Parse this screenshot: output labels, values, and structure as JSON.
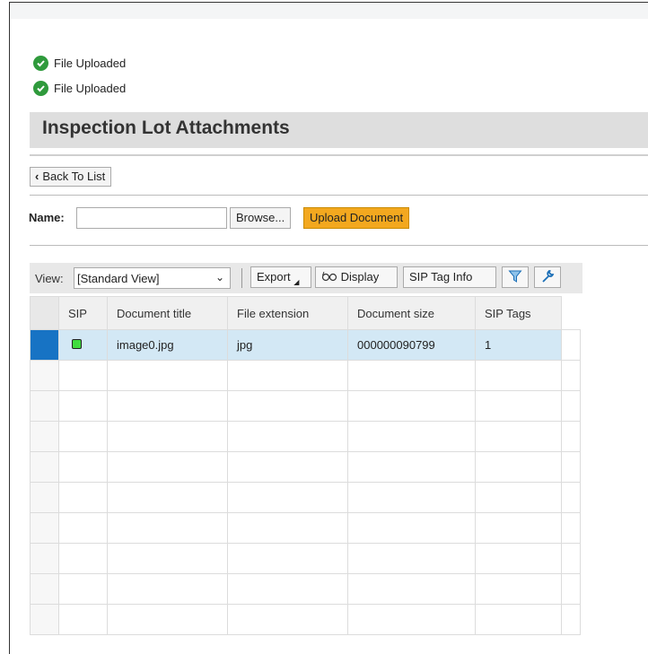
{
  "messages": [
    {
      "text": "File Uploaded",
      "icon": "success-check-icon"
    },
    {
      "text": "File Uploaded",
      "icon": "success-check-icon"
    }
  ],
  "page": {
    "title": "Inspection Lot Attachments"
  },
  "nav": {
    "back_label": "Back To List"
  },
  "upload": {
    "name_label": "Name:",
    "name_value": "",
    "browse_label": "Browse...",
    "upload_label": "Upload Document"
  },
  "toolbar": {
    "view_label": "View:",
    "view_value": "[Standard View]",
    "export_label": "Export",
    "display_label": "Display",
    "sip_tag_info_label": "SIP Tag Info",
    "filter_icon": "filter-icon",
    "settings_icon": "wrench-icon"
  },
  "table": {
    "columns": [
      "SIP",
      "Document title",
      "File extension",
      "Document size",
      "SIP Tags"
    ],
    "rows": [
      {
        "sip": "green",
        "title": "image0.jpg",
        "ext": "jpg",
        "size": "000000090799",
        "tags": "1"
      }
    ],
    "empty_row_count": 9
  },
  "colors": {
    "accent_upload": "#f3a81f",
    "selection": "#1773c4",
    "row_highlight": "#d3e8f5",
    "status_green": "#3fdc3f"
  }
}
